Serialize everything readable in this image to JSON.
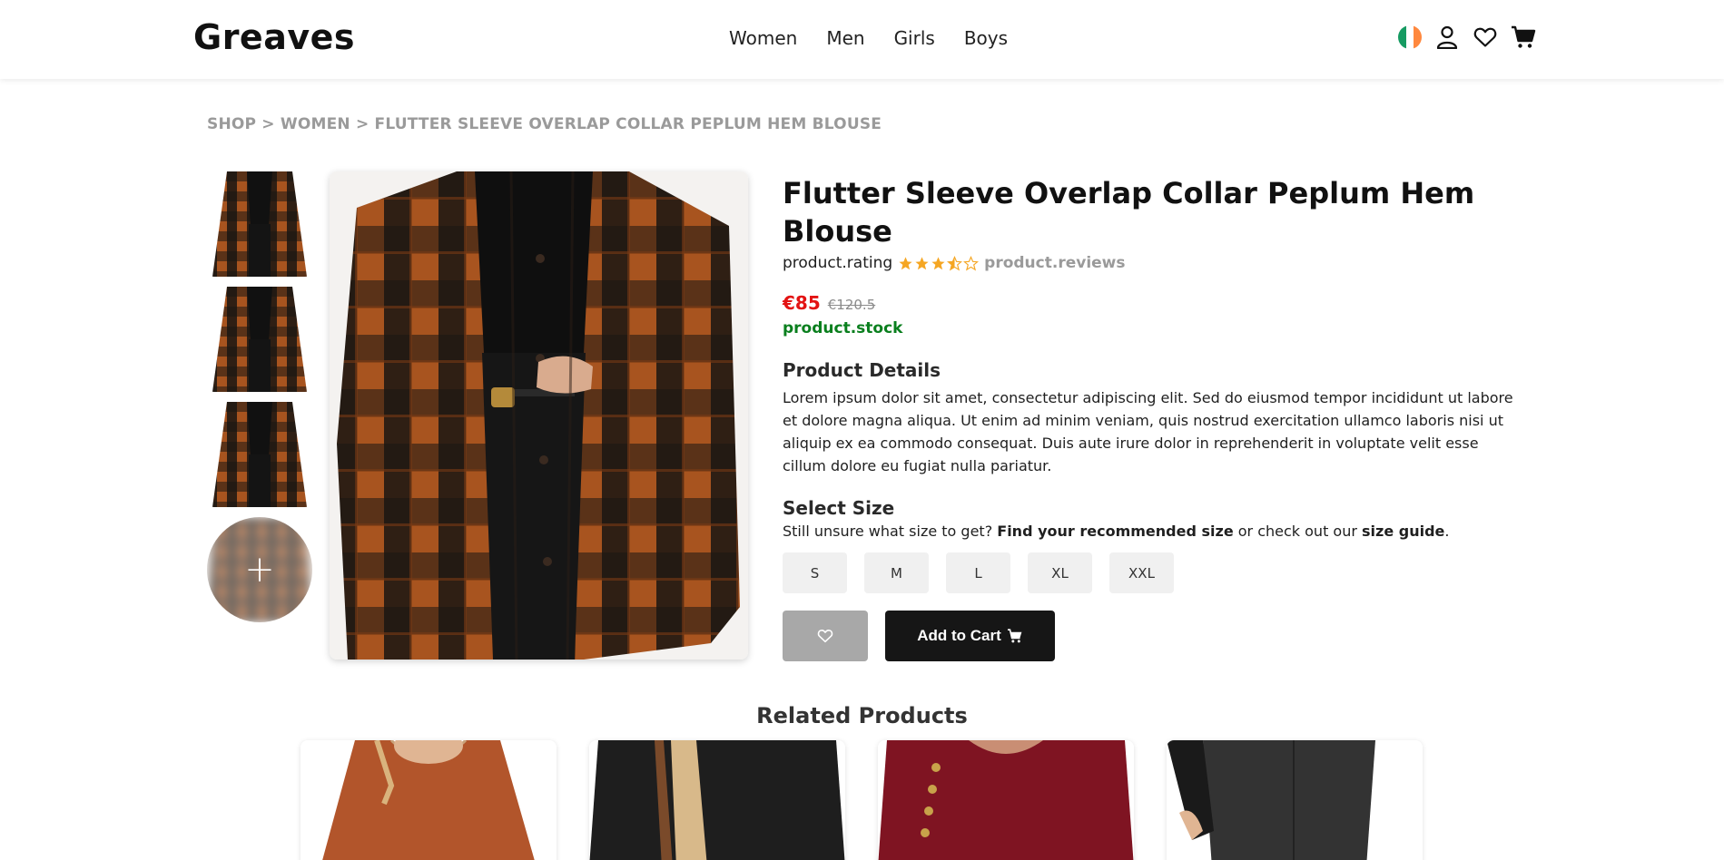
{
  "brand": {
    "logo": "Greaves"
  },
  "nav": {
    "items": [
      "Women",
      "Men",
      "Girls",
      "Boys"
    ]
  },
  "header_icons": [
    "ireland-flag-icon",
    "user-icon",
    "heart-icon",
    "cart-icon"
  ],
  "breadcrumb": {
    "text": "SHOP > WOMEN > FLUTTER SLEEVE OVERLAP COLLAR PEPLUM HEM BLOUSE"
  },
  "product": {
    "title": "Flutter Sleeve Overlap Collar Peplum Hem Blouse",
    "rating_label": "product.rating",
    "rating_value": 3.5,
    "rating_max": 5,
    "reviews_label": "product.reviews",
    "price": "€85",
    "old_price": "€120.5",
    "stock": "product.stock",
    "details_title": "Product Details",
    "description": "Lorem ipsum dolor sit amet, consectetur adipiscing elit. Sed do eiusmod tempor incididunt ut labore et dolore magna aliqua. Ut enim ad minim veniam, quis nostrud exercitation ullamco laboris nisi ut aliquip ex ea commodo consequat. Duis aute irure dolor in reprehenderit in voluptate velit esse cillum dolore eu fugiat nulla pariatur.",
    "size_title": "Select Size",
    "size_help_prefix": "Still unsure what size to get? ",
    "size_help_link1": "Find your recommended size",
    "size_help_mid": " or check out our ",
    "size_help_link2": "size guide",
    "size_help_suffix": ".",
    "sizes": [
      "S",
      "M",
      "L",
      "XL",
      "XXL"
    ],
    "add_to_cart": "Add to Cart"
  },
  "related": {
    "title": "Related Products"
  },
  "colors": {
    "price_red": "#e31313",
    "stock_green": "#0a7f1e",
    "star_orange": "#f5a623",
    "plaid_orange": "#a8541f",
    "plaid_black": "#161413"
  }
}
